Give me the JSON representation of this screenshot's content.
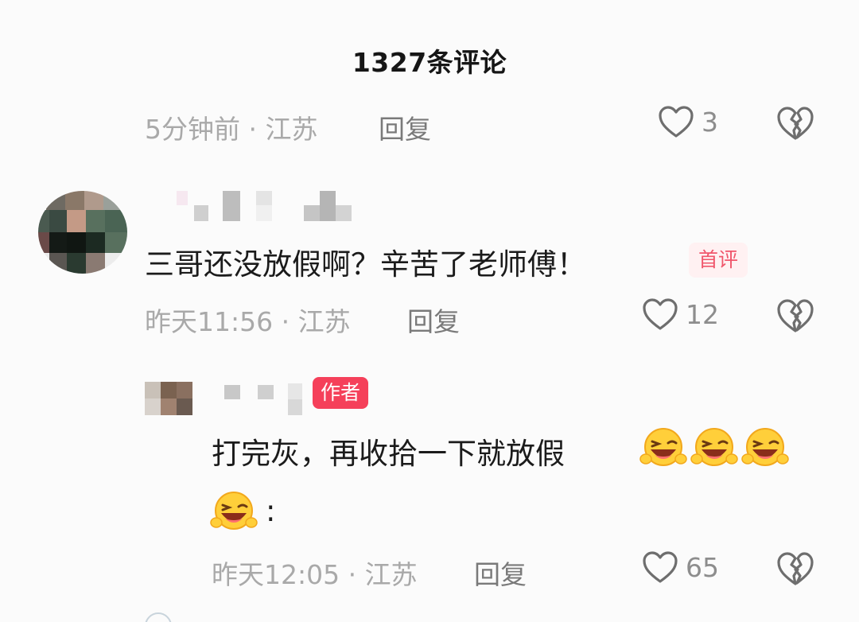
{
  "header": {
    "title": "1327条评论"
  },
  "comments": [
    {
      "meta": "5分钟前 · 江苏",
      "reply_label": "回复",
      "likes": "3"
    },
    {
      "text": "三哥还没放假啊？辛苦了老师傅！",
      "badge": "首评",
      "meta": "昨天11:56 · 江苏",
      "reply_label": "回复",
      "likes": "12",
      "replies": [
        {
          "badge": "作者",
          "text_line1": "打完灰，再收拾一下就放假",
          "text_line2_suffix": ":",
          "emoji_name": "grinning-squint-emoji",
          "meta": "昨天12:05 · 江苏",
          "reply_label": "回复",
          "likes": "65"
        }
      ]
    }
  ],
  "icons": {
    "like": "heart-outline-icon",
    "dislike": "broken-heart-icon"
  },
  "colors": {
    "accent_red": "#f5405a",
    "first_badge_bg": "#fff1f2",
    "meta_gray": "#a9a9a9"
  }
}
